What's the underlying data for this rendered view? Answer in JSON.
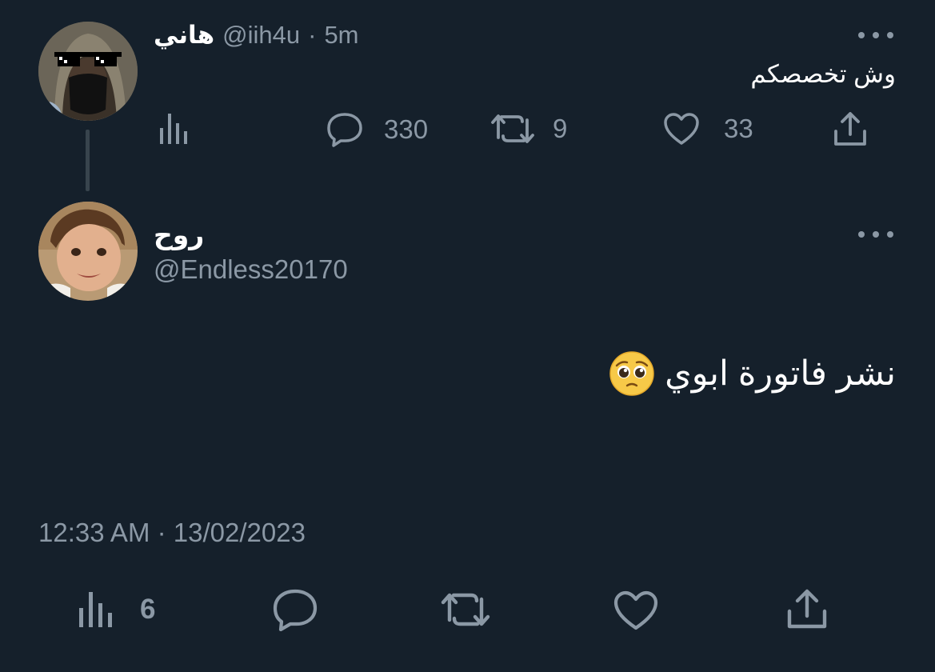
{
  "parent_tweet": {
    "display_name": "هاني",
    "handle": "@iih4u",
    "separator": "·",
    "time": "5m",
    "text": "وش تخصصكم",
    "actions": {
      "views_icon": "analytics-icon",
      "reply_count": "330",
      "retweet_count": "9",
      "like_count": "33",
      "share_icon": "share-icon"
    }
  },
  "reply_tweet": {
    "display_name": "روح",
    "handle": "@Endless20170",
    "text": "نشر فاتورة ابوي",
    "emoji": "pleading-face",
    "timestamp": "12:33 AM · 13/02/2023",
    "actions": {
      "views_count": "6"
    }
  },
  "colors": {
    "background": "#15202b",
    "text": "#ffffff",
    "secondary": "#8b98a5",
    "thread_line": "#38444d"
  }
}
